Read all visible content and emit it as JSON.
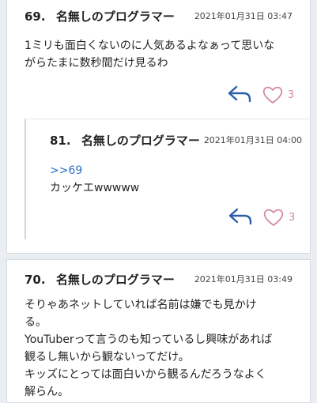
{
  "posts": [
    {
      "number": "69.",
      "name": "名無しのプログラマー",
      "date": "2021年01月31日 03:47",
      "lines": [
        "1ミリも面白くないのに人気あるよなぁって思いな",
        "がらたまに数秒間だけ見るわ"
      ],
      "likes": "3",
      "reply": {
        "number": "81.",
        "name": "名無しのプログラマー",
        "date": "2021年01月31日 04:00",
        "anchor": ">>69",
        "text": "カッケエwwwww",
        "likes": "3"
      }
    },
    {
      "number": "70.",
      "name": "名無しのプログラマー",
      "date": "2021年01月31日 03:49",
      "lines": [
        "そりゃあネットしていれば名前は嫌でも見かけ",
        "る。",
        "YouTuberって言うのも知っているし興味があれば",
        "観るし無いから観ないってだけ。",
        "キッズにとっては面白いから観るんだろうなよく",
        "解らん。"
      ]
    }
  ],
  "colors": {
    "accent": "#2a5fa8",
    "heart": "#d48aa0",
    "anchor": "#2a6fc7"
  },
  "icons": {
    "reply": "reply-arrow-icon",
    "like": "heart-icon"
  }
}
